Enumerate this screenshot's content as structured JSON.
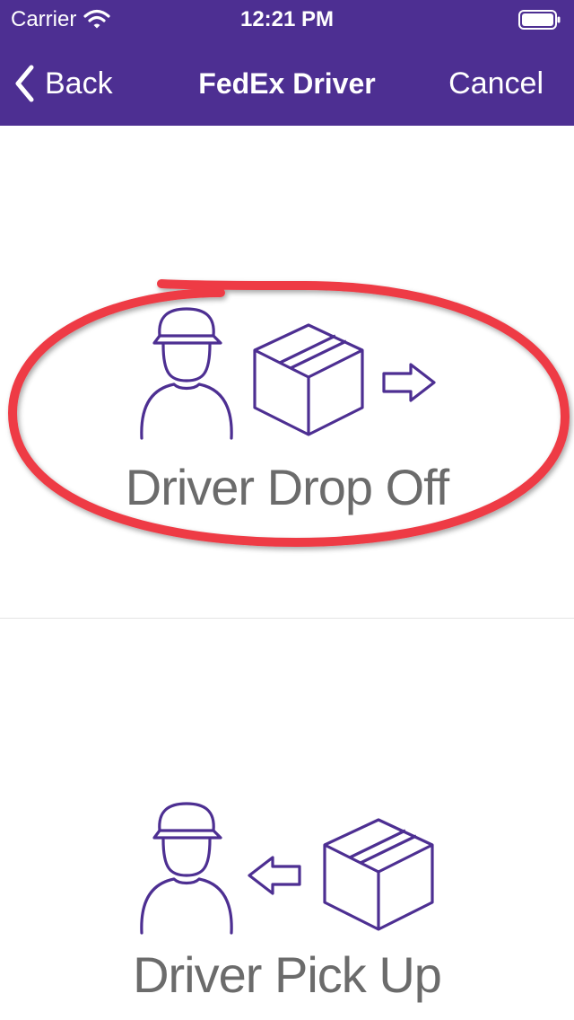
{
  "status_bar": {
    "carrier": "Carrier",
    "time": "12:21 PM",
    "icons": [
      "wifi-icon",
      "battery-icon"
    ]
  },
  "nav": {
    "back_label": "Back",
    "title": "FedEx Driver",
    "cancel_label": "Cancel",
    "icons": [
      "chevron-left-icon"
    ]
  },
  "options": [
    {
      "label": "Driver Drop Off",
      "icons": [
        "driver-icon",
        "package-box-icon",
        "arrow-right-icon"
      ],
      "highlighted": true
    },
    {
      "label": "Driver Pick Up",
      "icons": [
        "driver-icon",
        "arrow-left-icon",
        "package-box-icon"
      ],
      "highlighted": false
    }
  ],
  "colors": {
    "brand_purple": "#4d2f92",
    "label_gray": "#6b6b6b",
    "icon_purple": "#4d2f92",
    "highlight_red": "#ee3a45"
  }
}
